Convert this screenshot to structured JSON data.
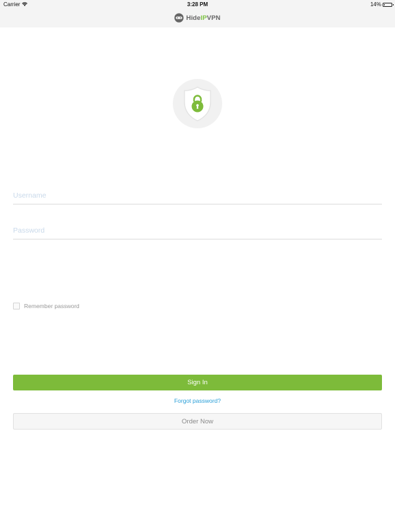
{
  "status_bar": {
    "carrier": "Carrier",
    "time": "3:28 PM",
    "battery_percent": "14%",
    "battery_level": 0.14
  },
  "brand": {
    "name_part1": "Hide",
    "name_accent": "IP",
    "name_part2": "VPN",
    "accent_color": "#7dc242"
  },
  "login": {
    "username_placeholder": "Username",
    "password_placeholder": "Password",
    "remember_label": "Remember password",
    "signin_label": "Sign In",
    "forgot_label": "Forgot password?",
    "order_label": "Order Now"
  },
  "icons": [
    "wifi-icon",
    "battery-icon",
    "hideipvpn-logo-icon",
    "shield-lock-icon"
  ],
  "colors": {
    "primary_green": "#7dbb3a",
    "link_blue": "#2a9fd8",
    "nav_bg": "#f4f4f4"
  }
}
